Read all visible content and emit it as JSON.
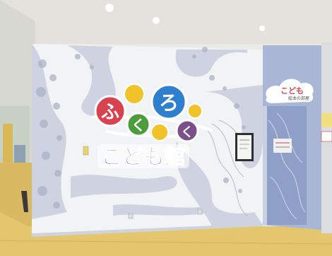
{
  "scene": {
    "type": "photo",
    "subject": "kids-library-entrance-wall"
  },
  "sign": {
    "medallions": [
      {
        "glyph": "ふ",
        "color": "#d9434f"
      },
      {
        "glyph": "く",
        "color": "#4a9d3a"
      },
      {
        "glyph": "ろ",
        "color": "#2f7fcf"
      },
      {
        "glyph": "く",
        "color": "#7a4f8a"
      }
    ],
    "title": "こども館",
    "title_colors": [
      "#6b4aa8",
      "#3f8fd1",
      "#d9434f",
      "#6b4aa8"
    ]
  },
  "door_plaque": {
    "main": "こども",
    "sub": "絵本の部屋"
  },
  "notice_board": {
    "text": ""
  },
  "palette": {
    "ceiling": "#e6e4de",
    "wall": "#f3f4f6",
    "wall_pattern": "#c9cede",
    "floor": "#e2c46a",
    "door_frame": "#a9b6d6"
  }
}
